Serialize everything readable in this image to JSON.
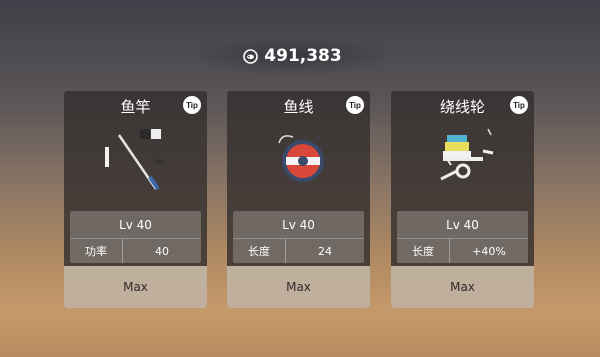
{
  "currency": {
    "icon": "coin-icon",
    "amount": "491,383"
  },
  "cards": [
    {
      "title": "鱼竿",
      "tip": "Tip",
      "icon": "fishing-rod-icon",
      "level": "Lv 40",
      "stat_label": "功率",
      "stat_value": "40",
      "action": "Max"
    },
    {
      "title": "鱼线",
      "tip": "Tip",
      "icon": "fishing-line-spool-icon",
      "level": "Lv 40",
      "stat_label": "长度",
      "stat_value": "24",
      "action": "Max"
    },
    {
      "title": "绕线轮",
      "tip": "Tip",
      "icon": "reel-icon",
      "level": "Lv 40",
      "stat_label": "长度",
      "stat_value": "+40%",
      "action": "Max"
    }
  ]
}
